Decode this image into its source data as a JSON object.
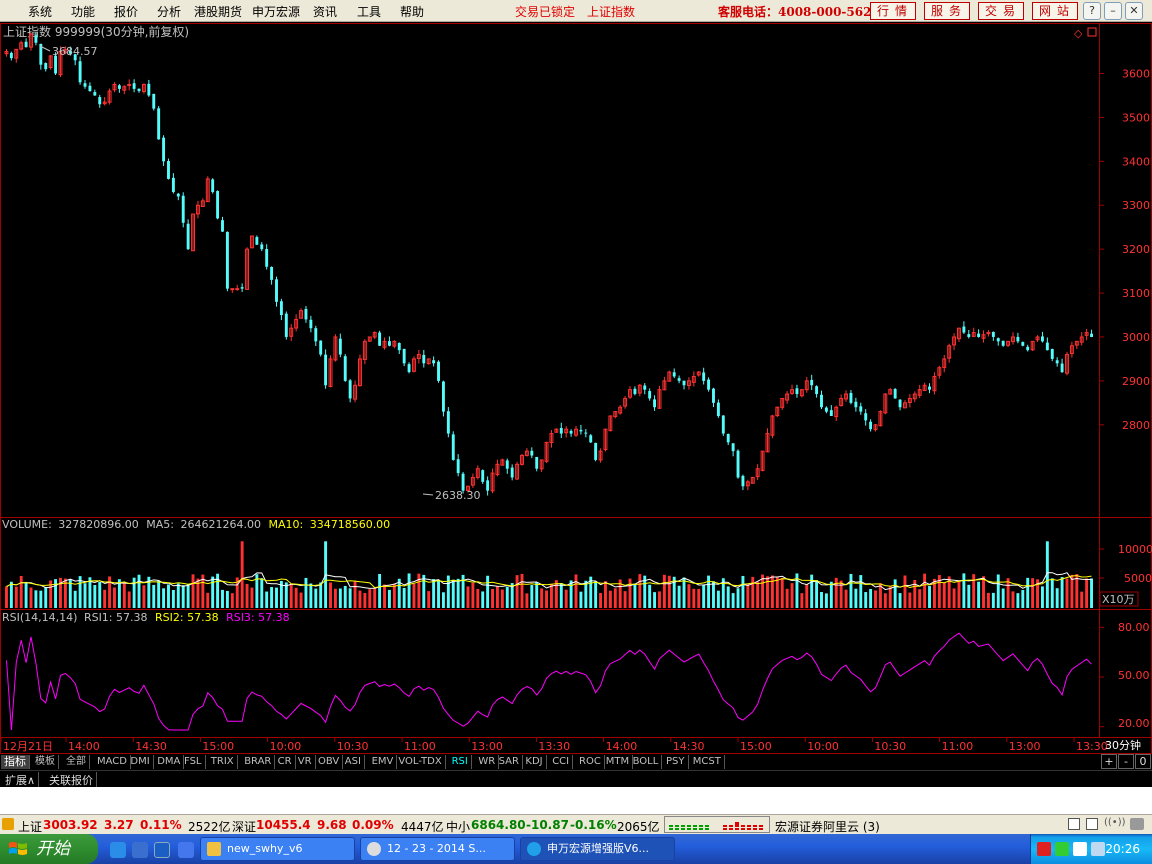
{
  "menu": {
    "items": [
      "系统",
      "功能",
      "报价",
      "分析",
      "港股期货",
      "申万宏源",
      "资讯",
      "工具",
      "帮助"
    ],
    "status1": "交易已锁定",
    "status2": "上证指数",
    "hotline": "客服电话：4008-000-562",
    "buttons": [
      "行情",
      "服务",
      "交易",
      "网站"
    ]
  },
  "chart_data": {
    "type": "candlestick",
    "title": "上证指数 999999(30分钟,前复权)",
    "price_axis": {
      "ticks": [
        2800,
        2900,
        3000,
        3100,
        3200,
        3300,
        3400,
        3500,
        3600
      ],
      "range": [
        2590,
        3715
      ]
    },
    "high_label": "3684.57",
    "low_label": "2638.30",
    "close_path": [
      3650,
      3635,
      3655,
      3670,
      3660,
      3690,
      3670,
      3620,
      3610,
      3640,
      3600,
      3650,
      3655,
      3645,
      3630,
      3580,
      3570,
      3560,
      3550,
      3530,
      3535,
      3560,
      3575,
      3565,
      3570,
      3575,
      3565,
      3560,
      3575,
      3550,
      3520,
      3450,
      3400,
      3360,
      3330,
      3320,
      3260,
      3200,
      3280,
      3300,
      3310,
      3360,
      3330,
      3270,
      3240,
      3110,
      3110,
      3110,
      3110,
      3200,
      3230,
      3210,
      3200,
      3160,
      3130,
      3080,
      3050,
      3000,
      3020,
      3040,
      3060,
      3040,
      3020,
      2990,
      2960,
      2890,
      2950,
      3000,
      2960,
      2900,
      2860,
      2890,
      2950,
      2990,
      3000,
      3010,
      2980,
      2990,
      2980,
      2990,
      2970,
      2940,
      2920,
      2950,
      2960,
      2940,
      2950,
      2940,
      2900,
      2830,
      2780,
      2720,
      2690,
      2650,
      2660,
      2680,
      2700,
      2670,
      2650,
      2690,
      2710,
      2720,
      2700,
      2680,
      2710,
      2730,
      2740,
      2730,
      2700,
      2720,
      2760,
      2780,
      2790,
      2780,
      2790,
      2780,
      2790,
      2785,
      2780,
      2760,
      2720,
      2740,
      2790,
      2820,
      2830,
      2840,
      2860,
      2880,
      2870,
      2890,
      2880,
      2860,
      2840,
      2880,
      2900,
      2920,
      2910,
      2900,
      2890,
      2900,
      2910,
      2920,
      2900,
      2880,
      2850,
      2820,
      2780,
      2760,
      2740,
      2680,
      2660,
      2670,
      2680,
      2700,
      2740,
      2780,
      2820,
      2840,
      2860,
      2870,
      2880,
      2870,
      2880,
      2900,
      2890,
      2870,
      2840,
      2830,
      2820,
      2840,
      2860,
      2870,
      2850,
      2840,
      2830,
      2810,
      2790,
      2800,
      2830,
      2870,
      2880,
      2860,
      2840,
      2850,
      2860,
      2870,
      2880,
      2890,
      2880,
      2910,
      2930,
      2950,
      2980,
      3000,
      3020,
      3010,
      3000,
      3010,
      3000,
      3005,
      3010,
      3000,
      2990,
      2980,
      2990,
      3000,
      2990,
      2980,
      2970,
      2990,
      3000,
      2990,
      2970,
      2950,
      2940,
      2920,
      2960,
      2980,
      2990,
      3000,
      3010,
      3000
    ],
    "volume": {
      "label": "VOLUME:",
      "value": "327820896.00",
      "ma5_label": "MA5:",
      "ma5": "264621264.00",
      "ma10_label": "MA10:",
      "ma10": "334718560.00",
      "ticks": [
        "10000",
        "5000"
      ],
      "unit": "X10万"
    },
    "rsi": {
      "params": "RSI(14,14,14)",
      "rsi1": "RSI1: 57.38",
      "rsi2": "RSI2: 57.38",
      "rsi3": "RSI3: 57.38",
      "ticks": [
        "80.00",
        "50.00",
        "20.00"
      ],
      "range": [
        15,
        85
      ]
    },
    "x_labels": [
      "12月21日",
      "14:00",
      "14:30",
      "15:00",
      "10:00",
      "10:30",
      "11:00",
      "13:00",
      "13:30",
      "14:00",
      "14:30",
      "15:00",
      "10:00",
      "10:30",
      "11:00",
      "13:00",
      "13:30"
    ],
    "period": "30分钟"
  },
  "colors": {
    "up": "#ff3232",
    "down": "#54fcfc",
    "axis": "#c00000",
    "rsi": "#ff00ff",
    "ma5": "#ffffff",
    "ma10": "#ffff00"
  },
  "indicator_tabs": [
    "指标",
    "模板",
    "全部",
    "MACD",
    "DMI",
    "DMA",
    "FSL",
    "TRIX",
    "BRAR",
    "CR",
    "VR",
    "OBV",
    "ASI",
    "EMV",
    "VOL-TDX",
    "RSI",
    "WR",
    "SAR",
    "KDJ",
    "CCI",
    "ROC",
    "MTM",
    "BOLL",
    "PSY",
    "MCST"
  ],
  "active_tab": "RSI",
  "tab_controls": [
    "+",
    "-",
    "0"
  ],
  "row2_tabs": [
    "扩展∧",
    "关联报价"
  ],
  "ticker": {
    "sh_name": "上证",
    "sh_val": "3003.92",
    "sh_chg": "3.27",
    "sh_pct": "0.11%",
    "sh_amt": "2522亿",
    "sz_name": "深证",
    "sz_val": "10455.4",
    "sz_chg": "9.68",
    "sz_pct": "0.09%",
    "sz_amt": "4447亿",
    "zx_name": "中小",
    "zx_val": "6864.80",
    "zx_chg": "-10.87",
    "zx_pct": "-0.16%",
    "zx_amt": "2065亿",
    "server": "宏源证券阿里云 (3)"
  },
  "taskbar": {
    "start": "开始",
    "tasks": [
      "new_swhy_v6",
      "12 - 23 - 2014 S...",
      "申万宏源增强版V6..."
    ],
    "clock": "20:26"
  }
}
